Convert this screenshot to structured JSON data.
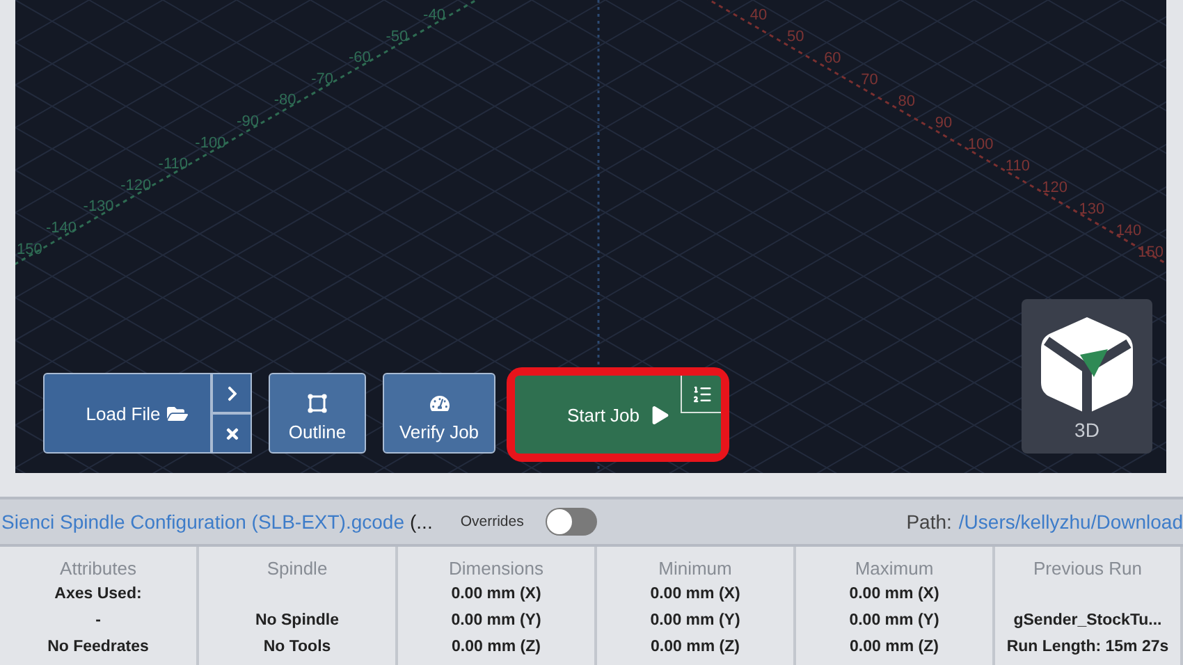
{
  "viewport": {
    "y_axis_labels": [
      "-40",
      "-50",
      "-60",
      "-70",
      "-80",
      "-90",
      "-100",
      "-110",
      "-120",
      "-130",
      "-140",
      "150"
    ],
    "x_axis_labels": [
      "40",
      "50",
      "60",
      "70",
      "80",
      "90",
      "100",
      "110",
      "120",
      "130",
      "140",
      "150"
    ]
  },
  "toolbar": {
    "load_file": {
      "label": "Load File"
    },
    "buttons": [
      {
        "kind": "outline",
        "label": "Outline"
      },
      {
        "kind": "verify",
        "label": "Verify Job"
      }
    ],
    "start_job": {
      "label": "Start Job",
      "highlighted": true
    }
  },
  "view_cube": {
    "label": "3D"
  },
  "file_bar": {
    "file_name": "Sienci Spindle Configuration (SLB-EXT).gcode",
    "file_suffix": "(...",
    "overrides": {
      "label": "Overrides",
      "on": false
    },
    "path_label": "Path:",
    "path": "/Users/kellyzhu/Download"
  },
  "stats": [
    {
      "title": "Attributes",
      "line_1": "Axes Used:",
      "line_2": "-",
      "line_3": "No Feedrates"
    },
    {
      "title": "Spindle",
      "line_2": "No Spindle",
      "line_3": "No Tools"
    },
    {
      "title": "Dimensions",
      "line_1": "0.00 mm (X)",
      "line_2": "0.00 mm (Y)",
      "line_3": "0.00 mm (Z)"
    },
    {
      "title": "Minimum",
      "line_1": "0.00 mm (X)",
      "line_2": "0.00 mm (Y)",
      "line_3": "0.00 mm (Z)"
    },
    {
      "title": "Maximum",
      "line_1": "0.00 mm (X)",
      "line_2": "0.00 mm (Y)",
      "line_3": "0.00 mm (Z)"
    },
    {
      "title": "Previous Run",
      "line_2": "gSender_StockTu...",
      "line_3": "Run Length: 15m 27s"
    }
  ]
}
